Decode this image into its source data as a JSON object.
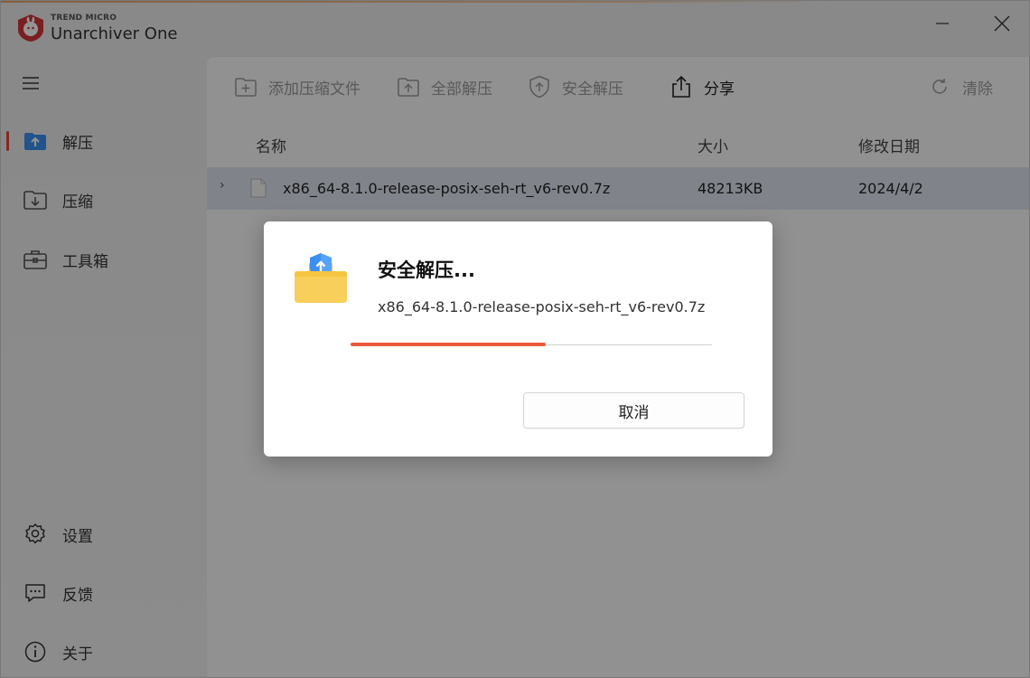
{
  "window": {
    "brand_small": "TREND MICRO",
    "brand_name": "Unarchiver One"
  },
  "sidebar": {
    "items": [
      {
        "label": "解压",
        "icon": "extract-icon",
        "active": true
      },
      {
        "label": "压缩",
        "icon": "compress-icon",
        "active": false
      },
      {
        "label": "工具箱",
        "icon": "toolbox-icon",
        "active": false
      }
    ],
    "bottom_items": [
      {
        "label": "设置",
        "icon": "gear-icon"
      },
      {
        "label": "反馈",
        "icon": "feedback-icon"
      },
      {
        "label": "关于",
        "icon": "info-icon"
      }
    ]
  },
  "toolbar": {
    "add_label": "添加压缩文件",
    "extract_all_label": "全部解压",
    "safe_extract_label": "安全解压",
    "share_label": "分享",
    "clear_label": "清除"
  },
  "table": {
    "headers": {
      "name": "名称",
      "size": "大小",
      "modified": "修改日期"
    },
    "rows": [
      {
        "name": "x86_64-8.1.0-release-posix-seh-rt_v6-rev0.7z",
        "size": "48213KB",
        "modified": "2024/4/2"
      }
    ]
  },
  "dialog": {
    "title": "安全解压...",
    "filename": "x86_64-8.1.0-release-posix-seh-rt_v6-rev0.7z",
    "progress": 0.54,
    "cancel_label": "取消"
  },
  "colors": {
    "accent": "#e85a3c",
    "selected_row": "#dce4ee",
    "folder": "#f5c542",
    "shield": "#3b8ff0"
  }
}
